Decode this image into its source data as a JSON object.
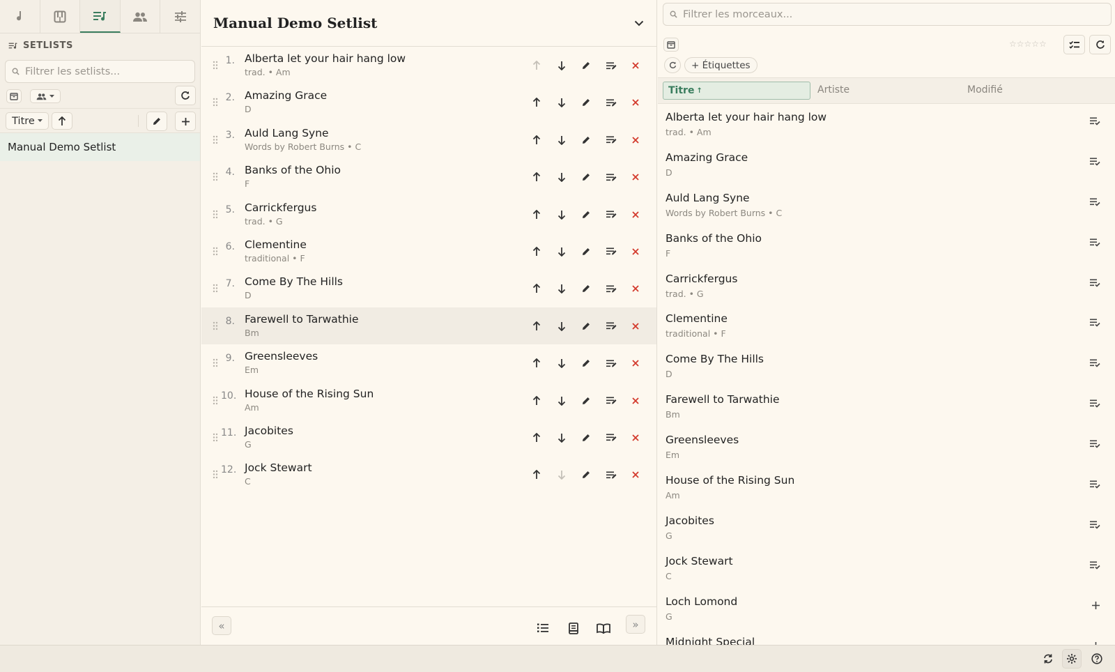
{
  "nav": {
    "tabs": [
      {
        "icon": "music-note-icon"
      },
      {
        "icon": "piano-icon"
      },
      {
        "icon": "setlist-icon",
        "active": true
      },
      {
        "icon": "people-icon"
      },
      {
        "icon": "tune-icon"
      }
    ]
  },
  "sidebar": {
    "header": "SETLISTS",
    "filter_placeholder": "Filtrer les setlists...",
    "sort_label": "Titre",
    "items": [
      {
        "label": "Manual Demo Setlist"
      }
    ]
  },
  "setlist": {
    "title": "Manual Demo Setlist",
    "songs": [
      {
        "num": "1.",
        "title": "Alberta let your hair hang low",
        "meta": "trad. • Am"
      },
      {
        "num": "2.",
        "title": "Amazing Grace",
        "meta": "D"
      },
      {
        "num": "3.",
        "title": "Auld Lang Syne",
        "meta": "Words by Robert Burns • C"
      },
      {
        "num": "4.",
        "title": "Banks of the Ohio",
        "meta": "F"
      },
      {
        "num": "5.",
        "title": "Carrickfergus",
        "meta": "trad. • G"
      },
      {
        "num": "6.",
        "title": "Clementine",
        "meta": "traditional • F"
      },
      {
        "num": "7.",
        "title": "Come By The Hills",
        "meta": "D"
      },
      {
        "num": "8.",
        "title": "Farewell to Tarwathie",
        "meta": "Bm"
      },
      {
        "num": "9.",
        "title": "Greensleeves",
        "meta": "Em"
      },
      {
        "num": "10.",
        "title": "House of the Rising Sun",
        "meta": "Am"
      },
      {
        "num": "11.",
        "title": "Jacobites",
        "meta": "G"
      },
      {
        "num": "12.",
        "title": "Jock Stewart",
        "meta": "C"
      }
    ],
    "footer": {
      "prev_label": "«",
      "next_label": "»"
    }
  },
  "library": {
    "filter_placeholder": "Filtrer les morceaux...",
    "stars": "☆☆☆☆☆",
    "tags_label": "+ Étiquettes",
    "columns": {
      "title": "Titre",
      "title_sort": "↑",
      "artist": "Artiste",
      "modified": "Modifié"
    },
    "songs": [
      {
        "title": "Alberta let your hair hang low",
        "meta": "trad. • Am",
        "in_setlist": true
      },
      {
        "title": "Amazing Grace",
        "meta": "D",
        "in_setlist": true
      },
      {
        "title": "Auld Lang Syne",
        "meta": "Words by Robert Burns • C",
        "in_setlist": true
      },
      {
        "title": "Banks of the Ohio",
        "meta": "F",
        "in_setlist": true
      },
      {
        "title": "Carrickfergus",
        "meta": "trad. • G",
        "in_setlist": true
      },
      {
        "title": "Clementine",
        "meta": "traditional • F",
        "in_setlist": true
      },
      {
        "title": "Come By The Hills",
        "meta": "D",
        "in_setlist": true
      },
      {
        "title": "Farewell to Tarwathie",
        "meta": "Bm",
        "in_setlist": true
      },
      {
        "title": "Greensleeves",
        "meta": "Em",
        "in_setlist": true
      },
      {
        "title": "House of the Rising Sun",
        "meta": "Am",
        "in_setlist": true
      },
      {
        "title": "Jacobites",
        "meta": "G",
        "in_setlist": true
      },
      {
        "title": "Jock Stewart",
        "meta": "C",
        "in_setlist": true
      },
      {
        "title": "Loch Lomond",
        "meta": "G",
        "in_setlist": false
      },
      {
        "title": "Midnight Special",
        "meta": "",
        "in_setlist": false
      }
    ]
  },
  "colors": {
    "accent": "#3a7d5e",
    "delete": "#d33a2c",
    "background": "#fdf8ef",
    "sidebar": "#f4efe6"
  }
}
